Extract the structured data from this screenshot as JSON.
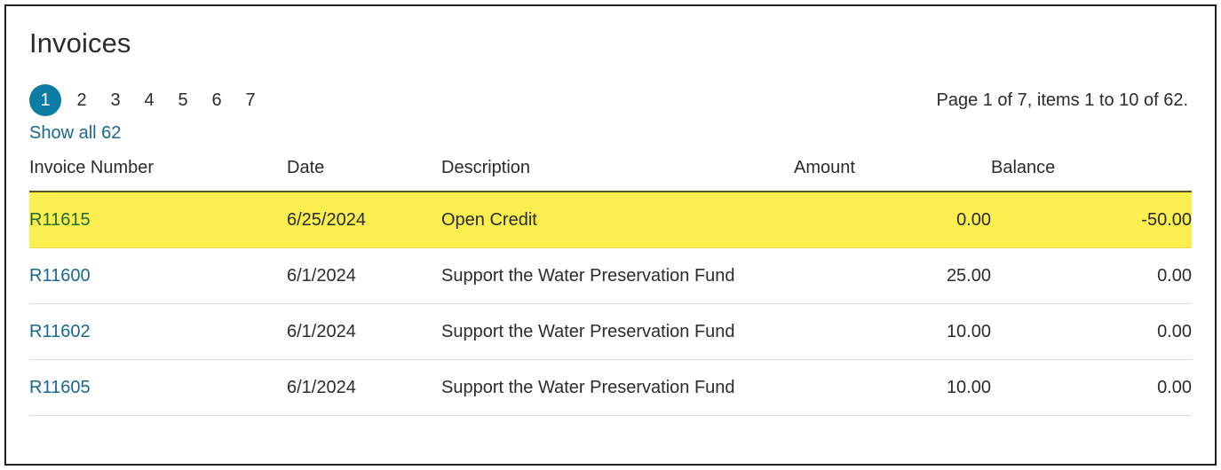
{
  "page": {
    "title": "Invoices"
  },
  "pagination": {
    "pages": [
      "1",
      "2",
      "3",
      "4",
      "5",
      "6",
      "7"
    ],
    "current_page": "1",
    "show_all_label": "Show all 62",
    "info": "Page 1 of 7, items 1 to 10 of 62.",
    "accent_color": "#0c7ca4",
    "link_color": "#17698c"
  },
  "table": {
    "headers": {
      "invoice_number": "Invoice Number",
      "date": "Date",
      "description": "Description",
      "amount": "Amount",
      "balance": "Balance"
    },
    "highlight_color": "#fbee4f",
    "rows": [
      {
        "invoice_number": "R11615",
        "date": "6/25/2024",
        "description": "Open Credit",
        "amount": "0.00",
        "balance": "-50.00",
        "highlighted": true
      },
      {
        "invoice_number": "R11600",
        "date": "6/1/2024",
        "description": "Support the Water Preservation Fund",
        "amount": "25.00",
        "balance": "0.00",
        "highlighted": false
      },
      {
        "invoice_number": "R11602",
        "date": "6/1/2024",
        "description": "Support the Water Preservation Fund",
        "amount": "10.00",
        "balance": "0.00",
        "highlighted": false
      },
      {
        "invoice_number": "R11605",
        "date": "6/1/2024",
        "description": "Support the Water Preservation Fund",
        "amount": "10.00",
        "balance": "0.00",
        "highlighted": false
      }
    ]
  }
}
